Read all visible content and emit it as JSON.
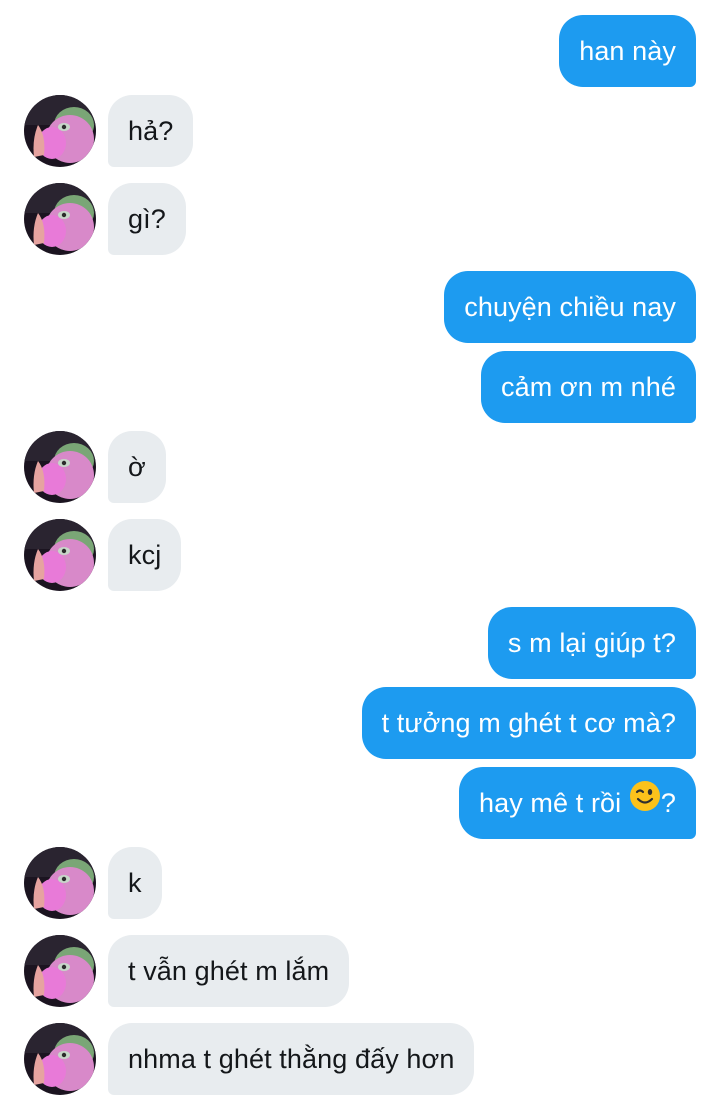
{
  "contact": {
    "avatar_icon": "contact-avatar-icon"
  },
  "colors": {
    "outgoing_bubble": "#1d9bf0",
    "incoming_bubble": "#e8ecef",
    "outgoing_text": "#ffffff",
    "incoming_text": "#14171a"
  },
  "messages": [
    {
      "direction": "out",
      "text": "han này"
    },
    {
      "direction": "in",
      "text": "hả?"
    },
    {
      "direction": "in",
      "text": "gì?"
    },
    {
      "direction": "out",
      "text": "chuyện chiều nay"
    },
    {
      "direction": "out",
      "text": "cảm ơn m nhé"
    },
    {
      "direction": "in",
      "text": "ờ"
    },
    {
      "direction": "in",
      "text": "kcj"
    },
    {
      "direction": "out",
      "text": "s m lại giúp t?"
    },
    {
      "direction": "out",
      "text": "t tưởng m ghét t cơ mà?"
    },
    {
      "direction": "out",
      "text_before": "hay mê t rồi",
      "emoji": "winking-face-emoji",
      "text_after": "?"
    },
    {
      "direction": "in",
      "text": "k"
    },
    {
      "direction": "in",
      "text": "t vẫn ghét m lắm"
    },
    {
      "direction": "in",
      "text": "nhma t ghét thằng đấy hơn"
    }
  ]
}
